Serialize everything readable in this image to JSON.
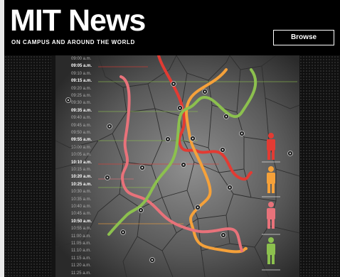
{
  "header": {
    "logo": "MIT News",
    "tagline": "ON CAMPUS AND AROUND THE WORLD",
    "browse_label": "Browse"
  },
  "timeline": [
    {
      "t": "09:00 a.m.",
      "major": false
    },
    {
      "t": "09:05 a.m.",
      "major": true
    },
    {
      "t": "09:10 a.m.",
      "major": false
    },
    {
      "t": "09:15 a.m.",
      "major": true
    },
    {
      "t": "09:20 a.m.",
      "major": false
    },
    {
      "t": "09:25 a.m.",
      "major": false
    },
    {
      "t": "09:30 a.m.",
      "major": false
    },
    {
      "t": "09:35 a.m.",
      "major": true
    },
    {
      "t": "09:40 a.m.",
      "major": false
    },
    {
      "t": "09:45 a.m.",
      "major": false
    },
    {
      "t": "09:50 a.m.",
      "major": false
    },
    {
      "t": "09:55 a.m.",
      "major": true
    },
    {
      "t": "10:00 a.m.",
      "major": false
    },
    {
      "t": "10:05 a.m.",
      "major": false
    },
    {
      "t": "10:10 a.m.",
      "major": true
    },
    {
      "t": "10:15 a.m.",
      "major": false
    },
    {
      "t": "10:20 a.m.",
      "major": true
    },
    {
      "t": "10:25 a.m.",
      "major": true
    },
    {
      "t": "10:30 a.m.",
      "major": false
    },
    {
      "t": "10:35 a.m.",
      "major": false
    },
    {
      "t": "10:40 a.m.",
      "major": false
    },
    {
      "t": "10:45 a.m.",
      "major": false
    },
    {
      "t": "10:50 a.m.",
      "major": true
    },
    {
      "t": "10:55 a.m.",
      "major": false
    },
    {
      "t": "11:00 a.m.",
      "major": false
    },
    {
      "t": "11:05 a.m.",
      "major": false
    },
    {
      "t": "11:10 a.m.",
      "major": false
    },
    {
      "t": "11:15 a.m.",
      "major": false
    },
    {
      "t": "11:20 a.m.",
      "major": false
    },
    {
      "t": "11:25 a.m.",
      "major": false
    }
  ],
  "colors": {
    "red": "#e23b33",
    "orange": "#f5a13a",
    "pink": "#e8727a",
    "green": "#8cc04e",
    "header_bg": "#000000"
  },
  "people_icons": [
    "person-red-icon",
    "person-orange-icon",
    "person-pink-icon",
    "person-green-icon"
  ]
}
